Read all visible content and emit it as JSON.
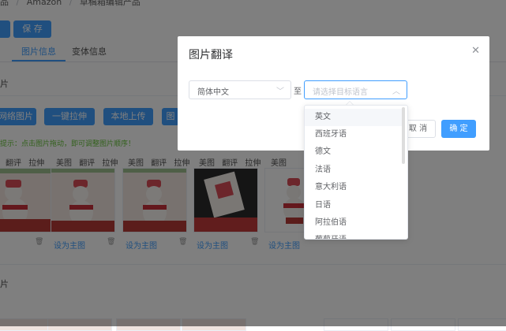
{
  "breadcrumb": {
    "part1": "品",
    "sep1": "/",
    "part2": "Amazon",
    "sep2": "/",
    "part3": "草稿箱编辑产品"
  },
  "toolbar": {
    "save_label": "保 存"
  },
  "tabs": [
    {
      "label": "图片信息"
    },
    {
      "label": "变体信息"
    }
  ],
  "section1": {
    "title_fragment": "片"
  },
  "image_buttons": {
    "web": "网络图片",
    "pull": "一键拉伸",
    "local": "本地上传",
    "more": "图"
  },
  "hint": "提示：点击图片拖动，即可调整图片顺序！",
  "image_actions": [
    {
      "a": "翻评",
      "b": "拉伸"
    },
    {
      "main": "美图",
      "a": "翻评",
      "b": "拉伸"
    },
    {
      "main": "美图",
      "a": "翻评",
      "b": "拉伸"
    },
    {
      "main": "美图",
      "a": "翻评",
      "b": "拉伸"
    },
    {
      "main": "美图"
    }
  ],
  "set_main_label": "设为主图",
  "section2": {
    "title_fragment": "片"
  },
  "dialog": {
    "title": "图片翻译",
    "source_lang": "简体中文",
    "to_label": "至",
    "target_placeholder": "请选择目标语言",
    "cancel_label": "取 消",
    "confirm_label": "确 定"
  },
  "dropdown_options": [
    {
      "label": "英文",
      "hover": true
    },
    {
      "label": "西班牙语"
    },
    {
      "label": "德文"
    },
    {
      "label": "法语"
    },
    {
      "label": "意大利语"
    },
    {
      "label": "日语"
    },
    {
      "label": "阿拉伯语"
    },
    {
      "label": "葡萄牙语"
    }
  ],
  "colors": {
    "primary": "#409eff",
    "hint": "#67c23a",
    "overlay": "rgba(0,0,0,0.5)"
  },
  "icons": {
    "close": "close-icon",
    "chevron-down": "chevron-down-icon",
    "chevron-up": "chevron-up-icon",
    "trash": "trash-icon"
  }
}
